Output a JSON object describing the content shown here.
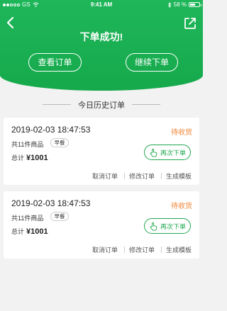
{
  "status_bar": {
    "carrier": "GS",
    "time": "9:41 AM",
    "battery_text": "58 %",
    "battery_level": 0.58
  },
  "header": {
    "title": "下单成功!",
    "view_orders_label": "查看订单",
    "continue_label": "继续下单"
  },
  "section": {
    "title": "今日历史订单"
  },
  "orders": [
    {
      "datetime": "2019-02-03 18:47:53",
      "status": "待收货",
      "item_count": "共11件商品",
      "meal_tag": "早餐",
      "total_label": "总计",
      "total_amount": "¥1001",
      "reorder_label": "再次下单",
      "actions": [
        "取消订单",
        "修改订单",
        "生成模板"
      ]
    },
    {
      "datetime": "2019-02-03 18:47:53",
      "status": "待收货",
      "item_count": "共11件商品",
      "meal_tag": "早餐",
      "total_label": "总计",
      "total_amount": "¥1001",
      "reorder_label": "再次下单",
      "actions": [
        "取消订单",
        "修改订单",
        "生成模板"
      ]
    }
  ],
  "colors": {
    "brand": "#1fb65a",
    "status": "#f0883a",
    "button": "#1fa84f"
  },
  "icons": [
    "back-icon",
    "share-icon",
    "wifi-icon",
    "bluetooth-icon",
    "hand-tap-icon"
  ]
}
